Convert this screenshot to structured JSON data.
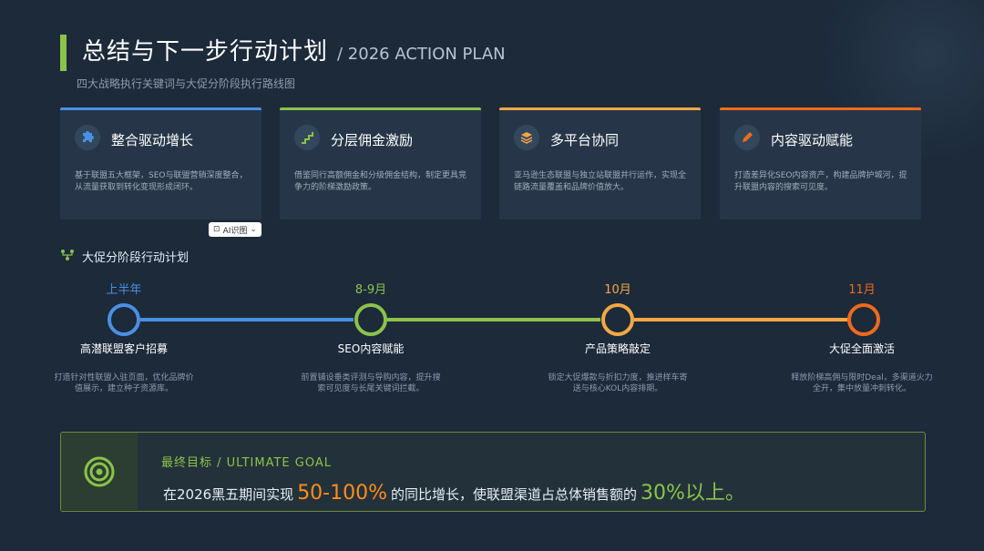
{
  "header": {
    "title": "总结与下一步行动计划",
    "title_en": "/ 2026 ACTION PLAN",
    "subtitle": "四大战略执行关键词与大促分阶段执行路线图"
  },
  "cards": [
    {
      "title": "整合驱动增长",
      "desc": "基于联盟五大框架，SEO与联盟营销深度整合，从流量获取到转化变现形成闭环。",
      "color": "#4a90e2",
      "icon": "puzzle-icon"
    },
    {
      "title": "分层佣金激励",
      "desc": "借鉴同行高额佣金和分级佣金结构，制定更具竞争力的阶梯激励政策。",
      "color": "#8bc34a",
      "icon": "stairs-icon"
    },
    {
      "title": "多平台协同",
      "desc": "亚马逊生态联盟与独立站联盟并行运作，实现全链路流量覆盖和品牌价值放大。",
      "color": "#f5a742",
      "icon": "layers-icon"
    },
    {
      "title": "内容驱动赋能",
      "desc": "打造差异化SEO内容资产，构建品牌护城河，提升联盟内容的搜索可见度。",
      "color": "#f06a1a",
      "icon": "pen-icon"
    }
  ],
  "ai_badge": {
    "label": "AI识图"
  },
  "timeline_section": {
    "title": "大促分阶段行动计划"
  },
  "timeline": [
    {
      "date": "上半年",
      "name": "高潜联盟客户招募",
      "desc": "打造针对性联盟入驻页面，优化品牌价值展示，建立种子资源库。",
      "color": "#4a90e2"
    },
    {
      "date": "8-9月",
      "name": "SEO内容赋能",
      "desc": "前置铺设垂类评测与导购内容，提升搜索可见度与长尾关键词拦截。",
      "color": "#8bc34a"
    },
    {
      "date": "10月",
      "name": "产品策略敲定",
      "desc": "锁定大促爆款与折扣力度，推进样车寄送与核心KOL内容排期。",
      "color": "#f5a742"
    },
    {
      "date": "11月",
      "name": "大促全面激活",
      "desc": "释放阶梯高佣与限时Deal，多渠道火力全开，集中放量冲刺转化。",
      "color": "#f06a1a"
    }
  ],
  "goal": {
    "label": "最终目标 / ULTIMATE GOAL",
    "text_pre": "在2026黑五期间实现",
    "highlight1": "50-100%",
    "text_mid": "的同比增长，使联盟渠道占总体销售额的",
    "highlight2": "30%以上。"
  }
}
